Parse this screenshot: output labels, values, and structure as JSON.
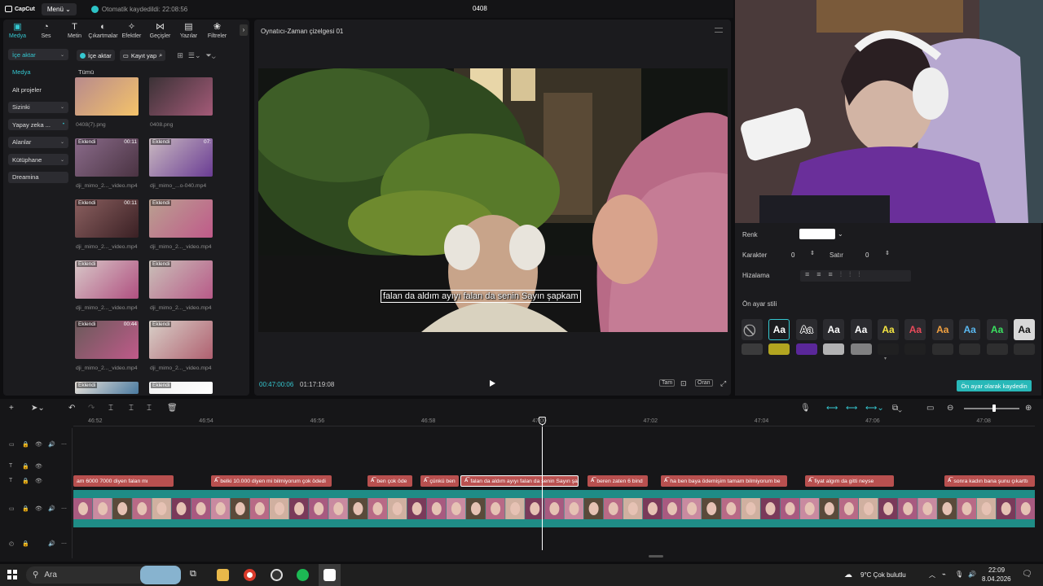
{
  "titlebar": {
    "logo": "CapCut",
    "menu_label": "Menü",
    "autosave": "Otomatik kaydedildi: 22:08:56",
    "project": "0408"
  },
  "categories": [
    {
      "label": "Medya",
      "icon": "media-icon",
      "glyph": "▣"
    },
    {
      "label": "Ses",
      "icon": "audio-icon",
      "glyph": "◔"
    },
    {
      "label": "Metin",
      "icon": "text-icon",
      "glyph": "T"
    },
    {
      "label": "Çıkartmalar",
      "icon": "sticker-icon",
      "glyph": "◐"
    },
    {
      "label": "Efektler",
      "icon": "effects-icon",
      "glyph": "✧"
    },
    {
      "label": "Geçişler",
      "icon": "transitions-icon",
      "glyph": "⋈"
    },
    {
      "label": "Yazılar",
      "icon": "captions-icon",
      "glyph": "▤"
    },
    {
      "label": "Filtreler",
      "icon": "filters-icon",
      "glyph": "❀"
    }
  ],
  "sidenav": [
    {
      "label": "İçe aktar",
      "state": "active",
      "chev": "⌄"
    },
    {
      "label": "Medya",
      "state": "sub",
      "chev": ""
    },
    {
      "label": "Alt projeler",
      "state": "",
      "chev": ""
    },
    {
      "label": "Sizinki",
      "state": "grey",
      "chev": "⌄"
    },
    {
      "label": "Yapay zeka ...",
      "state": "grey",
      "chev": "•"
    },
    {
      "label": "Alanlar",
      "state": "grey",
      "chev": "⌄"
    },
    {
      "label": "Kütüphane",
      "state": "grey",
      "chev": "⌄"
    },
    {
      "label": "Dreamina",
      "state": "grey",
      "chev": ""
    }
  ],
  "media": {
    "import_label": "İçe aktar",
    "record_label": "Kayıt yap",
    "all_label": "Tümü",
    "added_badge": "Eklendi",
    "items": [
      {
        "name": "0408(7).png",
        "badge": false,
        "dur": ""
      },
      {
        "name": "0408.png",
        "badge": false,
        "dur": ""
      },
      {
        "name": "dji_mimo_2..._video.mp4",
        "badge": true,
        "dur": "00:11"
      },
      {
        "name": "dji_mimo_...o-040.mp4",
        "badge": true,
        "dur": "07:"
      },
      {
        "name": "dji_mimo_2..._video.mp4",
        "badge": true,
        "dur": "00:11"
      },
      {
        "name": "dji_mimo_2..._video.mp4",
        "badge": true,
        "dur": ""
      },
      {
        "name": "dji_mimo_2..._video.mp4",
        "badge": true,
        "dur": ""
      },
      {
        "name": "dji_mimo_2..._video.mp4",
        "badge": true,
        "dur": ""
      },
      {
        "name": "dji_mimo_2..._video.mp4",
        "badge": true,
        "dur": "00:44"
      },
      {
        "name": "dji_mimo_2..._video.mp4",
        "badge": true,
        "dur": ""
      },
      {
        "name": "",
        "badge": true,
        "dur": ""
      },
      {
        "name": "",
        "badge": true,
        "dur": ""
      }
    ]
  },
  "player": {
    "title": "Oynatıcı-Zaman çizelgesi 01",
    "subtitle": "falan da aldım ayıyı falan da senin Sayın şapkam",
    "current_time": "00:47:00:06",
    "total_time": "01:17:19:08",
    "btn_full": "Tam",
    "btn_ratio": "Oran"
  },
  "props": {
    "color_label": "Renk",
    "char_label": "Karakter",
    "char_value": "0",
    "line_label": "Satır",
    "line_value": "0",
    "align_label": "Hizalama",
    "preset_label": "Ön ayar stili",
    "preset_sample": "Aa",
    "save_preset": "Ön ayar olarak kaydedin"
  },
  "timeline": {
    "ruler": [
      "46:52",
      "46:54",
      "46:56",
      "46:58",
      "47:00",
      "47:02",
      "47:04",
      "47:06",
      "47:08"
    ],
    "text_clips": [
      {
        "text": "am 6000 7000 diyen falan mı"
      },
      {
        "text": "belki 10.000 diyen mi bilmiyorum çok ödedi"
      },
      {
        "text": "ben çok öde"
      },
      {
        "text": "çünkü ben"
      },
      {
        "text": "falan da aldım ayıyı falan da senin Sayın şa"
      },
      {
        "text": "beren zaten 6 bind"
      },
      {
        "text": "ha ben baya ödemişim tamam bilmiyorum be"
      },
      {
        "text": "fiyat algım da gitti neyse"
      },
      {
        "text": "sonra kadın bana şunu çıkarttı"
      }
    ]
  },
  "taskbar": {
    "search_placeholder": "Ara",
    "weather": "9°C  Çok bulutlu",
    "time": "22:09",
    "date": "8.04.2026"
  },
  "colors": {
    "accent": "#35c7d0",
    "text_clip": "#b8504f",
    "video_clip": "#1f8c86"
  }
}
